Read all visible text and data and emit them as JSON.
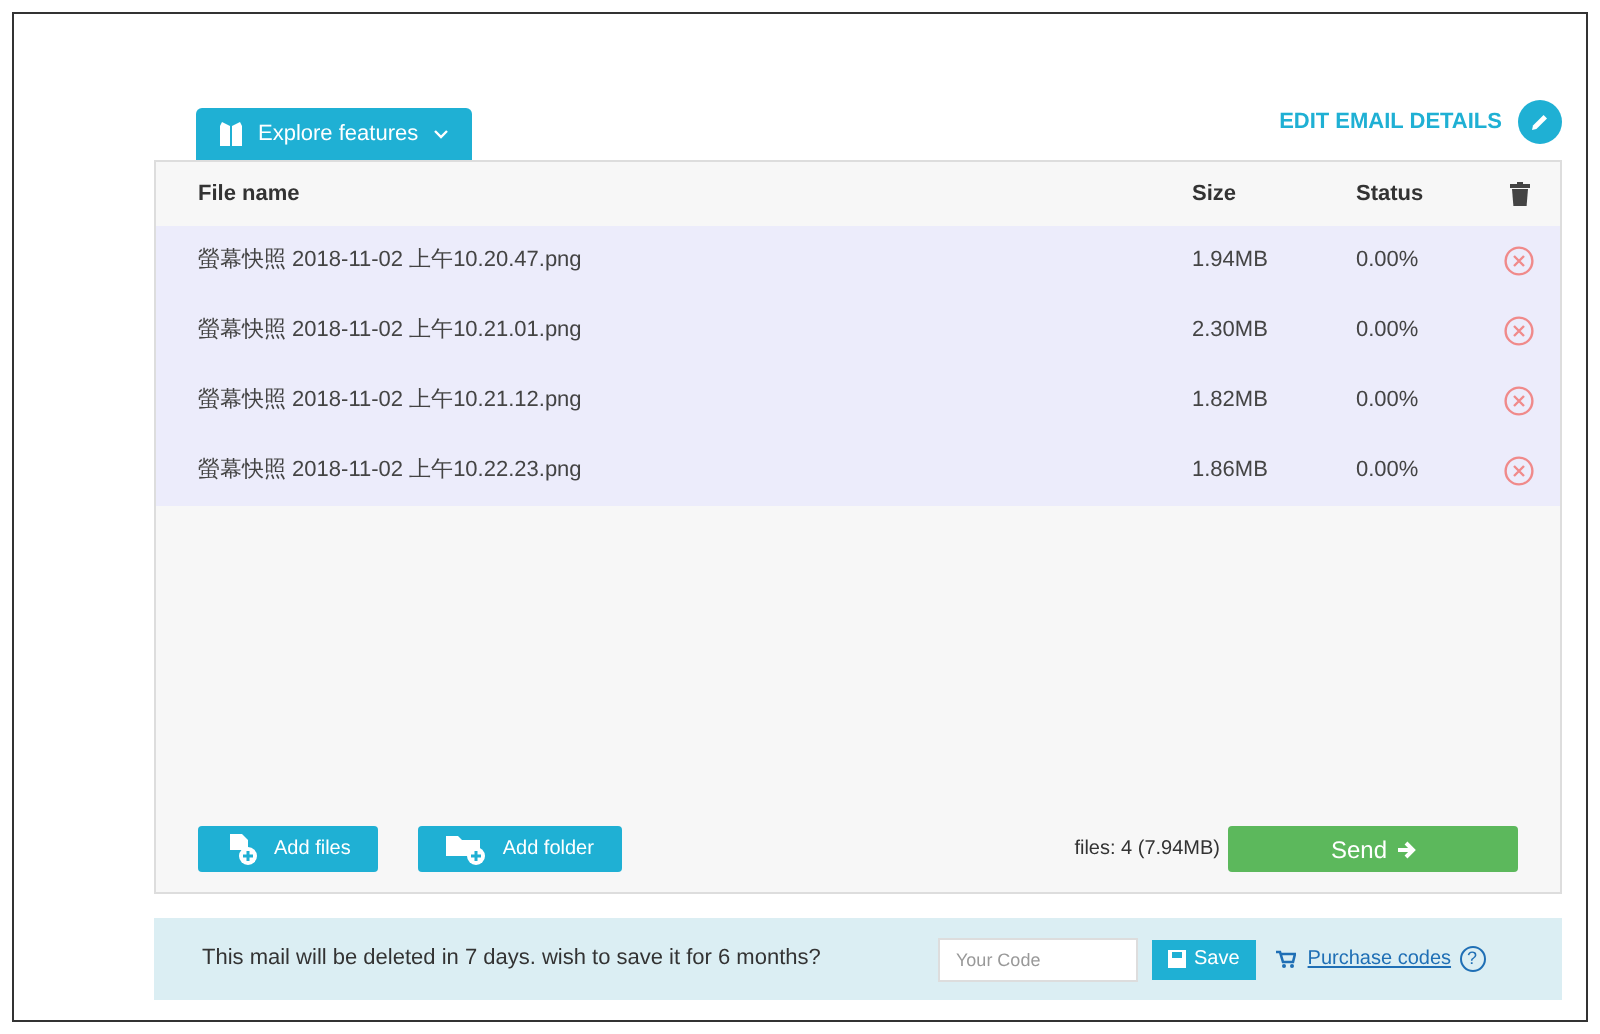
{
  "explore_tab": {
    "label": "Explore features"
  },
  "edit_email": {
    "label": "EDIT EMAIL DETAILS"
  },
  "table": {
    "columns": [
      "File name",
      "Size",
      "Status"
    ],
    "rows": [
      {
        "name": "螢幕快照 2018-11-02 上午10.20.47.png",
        "size": "1.94MB",
        "status": "0.00%"
      },
      {
        "name": "螢幕快照 2018-11-02 上午10.21.01.png",
        "size": "2.30MB",
        "status": "0.00%"
      },
      {
        "name": "螢幕快照 2018-11-02 上午10.21.12.png",
        "size": "1.82MB",
        "status": "0.00%"
      },
      {
        "name": "螢幕快照 2018-11-02 上午10.22.23.png",
        "size": "1.86MB",
        "status": "0.00%"
      }
    ]
  },
  "buttons": {
    "add_files": "Add files",
    "add_folder": "Add folder",
    "send": "Send"
  },
  "summary": "files: 4 (7.94MB)",
  "save_bar": {
    "message": "This mail will be deleted in 7 days. wish to save it for 6 months?",
    "code_placeholder": "Your Code",
    "save": "Save",
    "purchase": "Purchase codes",
    "help": "?"
  }
}
